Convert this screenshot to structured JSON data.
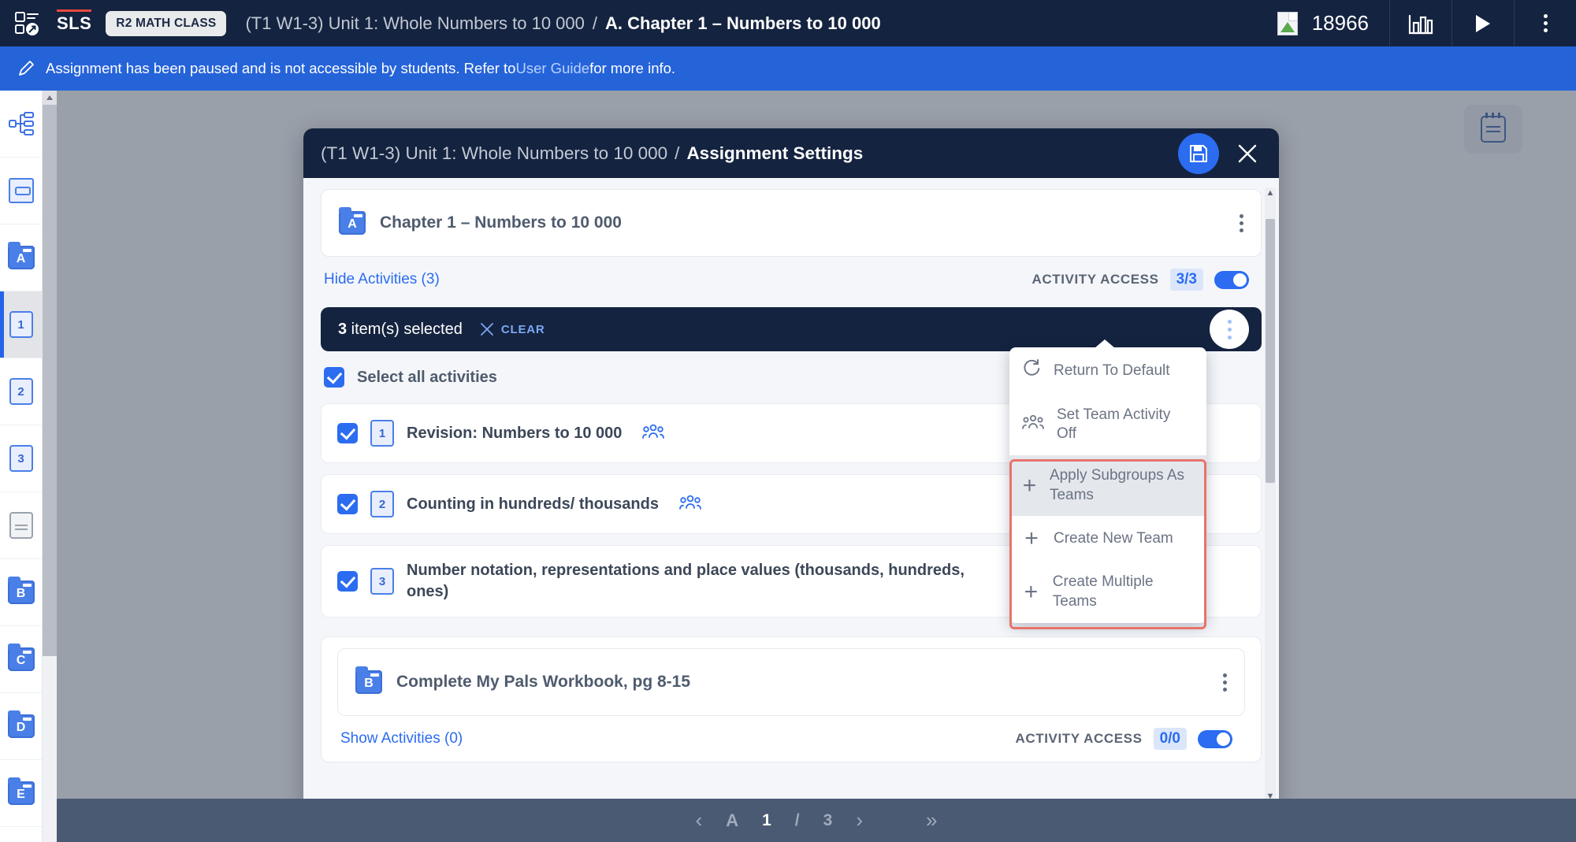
{
  "topbar": {
    "app_icon": "checklist-expand-icon",
    "brand": "SLS",
    "class_chip": "R2 MATH CLASS",
    "breadcrumb_parent": "(T1 W1-3) Unit 1: Whole Numbers to 10 000",
    "breadcrumb_sep": "/",
    "breadcrumb_current": "A. Chapter 1 – Numbers to 10 000",
    "broken_image_icon": "broken-image-icon",
    "points": "18966",
    "chart_icon": "bar-chart-icon",
    "play_icon": "play-icon",
    "more_icon": "kebab-menu-icon"
  },
  "notice": {
    "icon": "pencil-icon",
    "text_before": "Assignment has been paused and is not accessible by students. Refer to ",
    "link": "User Guide",
    "text_after": " for more info."
  },
  "rail": {
    "items": [
      {
        "name": "sitemap-icon",
        "label": ""
      },
      {
        "name": "book-icon",
        "label": ""
      },
      {
        "name": "folder-a-icon",
        "label": "A"
      },
      {
        "name": "doc-1-icon",
        "label": "1",
        "active": true
      },
      {
        "name": "doc-2-icon",
        "label": "2"
      },
      {
        "name": "doc-3-icon",
        "label": "3"
      },
      {
        "name": "doc-text-icon",
        "label": ""
      },
      {
        "name": "folder-b-icon",
        "label": "B"
      },
      {
        "name": "folder-c-icon",
        "label": "C"
      },
      {
        "name": "folder-d-icon",
        "label": "D"
      },
      {
        "name": "folder-e-icon",
        "label": "E"
      }
    ]
  },
  "page": {
    "notepad_icon": "notepad-icon"
  },
  "modal": {
    "title_parent": "(T1 W1-3) Unit 1: Whole Numbers to 10 000",
    "title_sep": "/",
    "title_current": "Assignment Settings",
    "save_icon": "save-floppy-icon",
    "close_icon": "close-x-icon",
    "chapter": {
      "icon_letter": "A",
      "title": "Chapter 1 – Numbers to 10 000",
      "kebab": "kebab-menu-icon"
    },
    "activities_toggle_link": "Hide Activities (3)",
    "access_label": "ACTIVITY ACCESS",
    "access_count": "3/3",
    "selection": {
      "count": "3",
      "count_suffix": " item(s) selected",
      "clear_label": "CLEAR",
      "clear_icon": "close-x-icon",
      "kebab": "kebab-menu-icon"
    },
    "select_all_label": "Select all activities",
    "activities": [
      {
        "num": "1",
        "title": "Revision: Numbers to 10 000",
        "team_icon": "team-group-icon",
        "checked": true
      },
      {
        "num": "2",
        "title": "Counting in hundreds/ thousands",
        "team_icon": "team-group-icon",
        "checked": true
      },
      {
        "num": "3",
        "title": "Number notation, representations and place values (thousands, hundreds, ones)",
        "team_icon": "",
        "checked": true
      }
    ],
    "section_b": {
      "icon_letter": "B",
      "title": "Complete My Pals Workbook, pg 8-15",
      "kebab": "kebab-menu-icon",
      "activities_toggle_link": "Show Activities (0)",
      "access_label": "ACTIVITY ACCESS",
      "access_count": "0/0"
    }
  },
  "context_menu": {
    "items": [
      {
        "label": "Return To Default",
        "icon": "refresh-icon",
        "highlighted": false,
        "outlined": false
      },
      {
        "label": "Set Team Activity Off",
        "icon": "team-group-icon",
        "highlighted": false,
        "outlined": false
      },
      {
        "label": "Apply Subgroups As Teams",
        "icon": "plus-icon",
        "highlighted": true,
        "outlined": true
      },
      {
        "label": "Create New Team",
        "icon": "plus-icon",
        "highlighted": false,
        "outlined": true
      },
      {
        "label": "Create Multiple Teams",
        "icon": "plus-icon",
        "highlighted": false,
        "outlined": true
      }
    ],
    "outline_color": "#e8736a"
  },
  "pager": {
    "prev_icon": "chevron-left-icon",
    "letter": "A",
    "current": "1",
    "sep": "/",
    "total": "3",
    "next_icon": "chevron-right-icon",
    "last_icon": "chevron-double-right-icon"
  },
  "colors": {
    "brand_dark": "#14233f",
    "accent_blue": "#2b6cf0",
    "notice_blue": "#2563d9",
    "outline_red": "#e8736a"
  }
}
